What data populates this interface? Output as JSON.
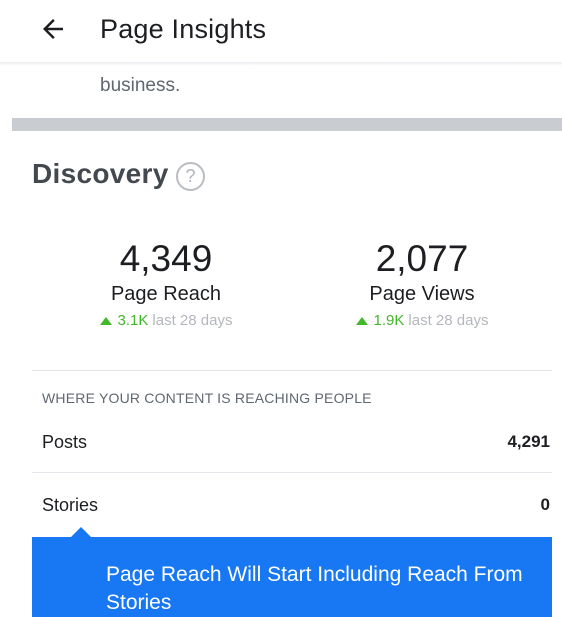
{
  "header": {
    "title": "Page Insights",
    "back_icon": "back-arrow-icon"
  },
  "intro": {
    "business_text": "business."
  },
  "discovery": {
    "title": "Discovery",
    "help_symbol": "?",
    "metrics": [
      {
        "value": "4,349",
        "label": "Page Reach",
        "trend_value": "3.1K",
        "trend_text": "last 28 days",
        "trend_direction": "up"
      },
      {
        "value": "2,077",
        "label": "Page Views",
        "trend_value": "1.9K",
        "trend_text": "last 28 days",
        "trend_direction": "up"
      }
    ],
    "reach_section": {
      "heading": "WHERE YOUR CONTENT IS REACHING PEOPLE",
      "rows": [
        {
          "label": "Posts",
          "value": "4,291"
        },
        {
          "label": "Stories",
          "value": "0"
        }
      ]
    }
  },
  "tooltip": {
    "text": "Page Reach Will Start Including Reach From Stories"
  },
  "colors": {
    "trend_up": "#42b72a",
    "tooltip_bg": "#1877f2",
    "divider": "#c9ccd1"
  }
}
